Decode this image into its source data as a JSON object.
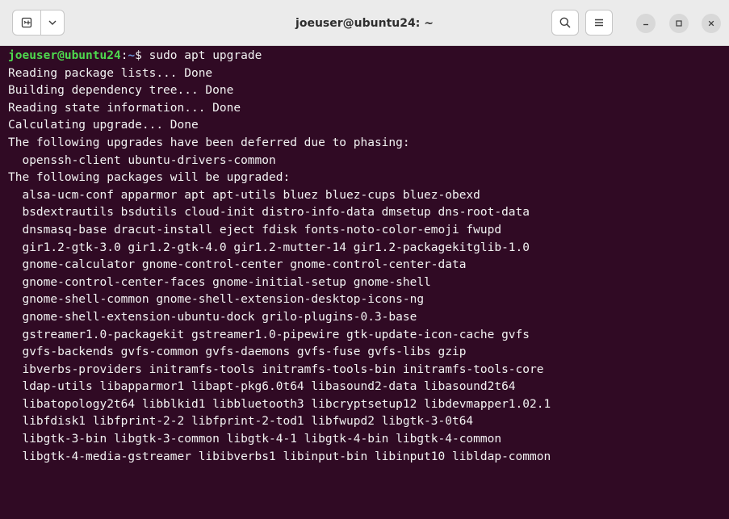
{
  "window": {
    "title": "joeuser@ubuntu24: ~"
  },
  "header": {
    "new_tab_icon": "terminal-new-tab-icon",
    "dropdown_icon": "chevron-down-icon",
    "search_icon": "search-icon",
    "menu_icon": "hamburger-menu-icon",
    "minimize_icon": "minimize-icon",
    "maximize_icon": "maximize-icon",
    "close_icon": "close-icon"
  },
  "colors": {
    "terminal_bg": "#300a24",
    "prompt_user": "#4ed94e",
    "prompt_path": "#6a93d8",
    "text": "#f2f2f2",
    "header_bg": "#ebebeb"
  },
  "terminal": {
    "prompt": {
      "user_host": "joeuser@ubuntu24",
      "colon": ":",
      "path": "~",
      "dollar": "$",
      "command": " sudo apt upgrade"
    },
    "output": [
      "Reading package lists... Done",
      "Building dependency tree... Done",
      "Reading state information... Done",
      "Calculating upgrade... Done",
      "The following upgrades have been deferred due to phasing:",
      "  openssh-client ubuntu-drivers-common",
      "The following packages will be upgraded:",
      "  alsa-ucm-conf apparmor apt apt-utils bluez bluez-cups bluez-obexd",
      "  bsdextrautils bsdutils cloud-init distro-info-data dmsetup dns-root-data",
      "  dnsmasq-base dracut-install eject fdisk fonts-noto-color-emoji fwupd",
      "  gir1.2-gtk-3.0 gir1.2-gtk-4.0 gir1.2-mutter-14 gir1.2-packagekitglib-1.0",
      "  gnome-calculator gnome-control-center gnome-control-center-data",
      "  gnome-control-center-faces gnome-initial-setup gnome-shell",
      "  gnome-shell-common gnome-shell-extension-desktop-icons-ng",
      "  gnome-shell-extension-ubuntu-dock grilo-plugins-0.3-base",
      "  gstreamer1.0-packagekit gstreamer1.0-pipewire gtk-update-icon-cache gvfs",
      "  gvfs-backends gvfs-common gvfs-daemons gvfs-fuse gvfs-libs gzip",
      "  ibverbs-providers initramfs-tools initramfs-tools-bin initramfs-tools-core",
      "  ldap-utils libapparmor1 libapt-pkg6.0t64 libasound2-data libasound2t64",
      "  libatopology2t64 libblkid1 libbluetooth3 libcryptsetup12 libdevmapper1.02.1",
      "  libfdisk1 libfprint-2-2 libfprint-2-tod1 libfwupd2 libgtk-3-0t64",
      "  libgtk-3-bin libgtk-3-common libgtk-4-1 libgtk-4-bin libgtk-4-common",
      "  libgtk-4-media-gstreamer libibverbs1 libinput-bin libinput10 libldap-common"
    ]
  }
}
